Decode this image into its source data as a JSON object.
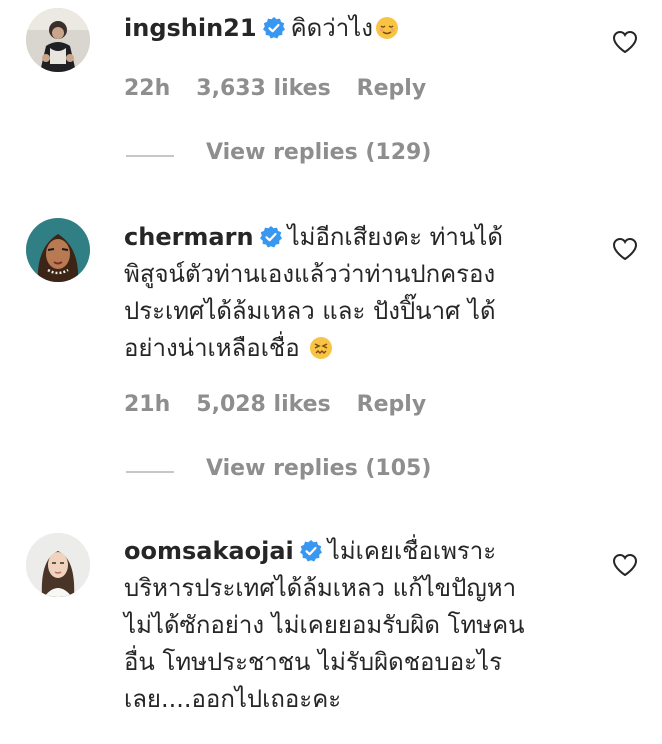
{
  "comments": [
    {
      "username": "ingshin21",
      "lines": [
        "คิดว่าไง"
      ],
      "emoji": "relieved-face",
      "time": "22h",
      "likes": "3,633 likes",
      "reply": "Reply",
      "view_replies": "View replies (129)"
    },
    {
      "username": "chermarn",
      "lines": [
        "ไม่อีกเสียงคะ ท่านได้",
        "พิสูจน์ตัวท่านเองแล้วว่าท่านปกครอง",
        "ประเทศได้ล้มเหลว และ ปังปิ๊นาศ ได้",
        "อย่างน่าเหลือเชื่อ"
      ],
      "emoji": "confounded-face",
      "time": "21h",
      "likes": "5,028 likes",
      "reply": "Reply",
      "view_replies": "View replies (105)"
    },
    {
      "username": "oomsakaojai",
      "lines": [
        "ไม่เคยเชื่อเพราะ",
        "บริหารประเทศได้ล้มเหลว แก้ไขปัญหา",
        "ไม่ได้ซักอย่าง ไม่เคยยอมรับผิด โทษคน",
        "อื่น โทษประชาชน ไม่รับผิดชอบอะไร",
        "เลย....ออกไปเถอะคะ"
      ]
    }
  ],
  "colors": {
    "text": "#262626",
    "secondary": "#8e8e8e",
    "verified": "#3897f0",
    "divider": "#c7c7c7"
  }
}
